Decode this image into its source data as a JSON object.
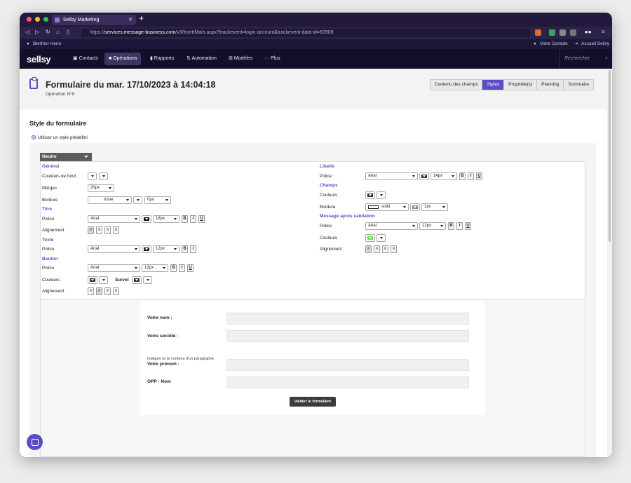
{
  "browser": {
    "tab_title": "Sellsy Marketing",
    "url_prefix": "https://",
    "url_domain": "services.message-business.com",
    "url_path": "/v3/front/Main.aspx?trackevent=login-account&trackevent-data-id=60908"
  },
  "userbar": {
    "user": "Berthier Henn",
    "account": "Votre Compte",
    "home": "Accueil Sellsy"
  },
  "nav": {
    "logo": "sellsy",
    "items": [
      "Contacts",
      "Opérations",
      "Rapports",
      "Automation",
      "Modèles",
      "Plus"
    ],
    "search_placeholder": "Rechercher"
  },
  "header": {
    "title": "Formulaire du mar. 17/10/2023 à 14:04:18",
    "subtitle": "Opération N°8",
    "tabs": [
      "Contenu des champs",
      "Styles",
      "Propriété(s)",
      "Planning",
      "Sommaire"
    ]
  },
  "style": {
    "title": "Style du formulaire",
    "radio_label": "Utiliser un style prédéfini",
    "preset": "Neutre"
  },
  "left": {
    "general": "Général",
    "bg_label": "Couleurs de fond",
    "margins_label": "Marges",
    "margins_value": "20px",
    "border_label": "Bordure",
    "border_style": "none",
    "border_size": "0px",
    "title_section": "Titre",
    "title_font_label": "Police",
    "title_font": "Arial",
    "title_size": "18px",
    "title_align_label": "Alignement",
    "text_section": "Texte",
    "text_font_label": "Police",
    "text_font": "Arial",
    "text_size": "12px",
    "button_section": "Bouton",
    "button_font_label": "Police",
    "button_font": "Arial",
    "button_size": "12px",
    "button_colors_label": "Couleurs",
    "hover_label": "Survol",
    "button_align_label": "Alignement"
  },
  "right": {
    "label_section": "Libellé",
    "label_font_label": "Police",
    "label_font": "Arial",
    "label_size": "14px",
    "fields_section": "Champs",
    "fields_colors_label": "Couleurs",
    "fields_border_label": "Bordure",
    "fields_border_style": "solid",
    "fields_border_size": "1px",
    "msg_section": "Message après validation",
    "msg_font_label": "Police",
    "msg_font": "Arial",
    "msg_size": "12px",
    "msg_colors_label": "Couleurs",
    "msg_align_label": "Alignement"
  },
  "format_buttons": {
    "bold": "B",
    "italic": "I",
    "underline": "U"
  },
  "colors": {
    "accent": "#5a4ec6",
    "dark_swatch": "#222222",
    "green_swatch": "#6fdc3c"
  },
  "preview": {
    "fields": [
      "Votre nom :",
      "Votre société :",
      "Votre prénom :",
      "OPP - Nom"
    ],
    "paragraph": "Indiquer ici le contenu d'un paragraphe",
    "submit": "Valider le formulaire"
  }
}
